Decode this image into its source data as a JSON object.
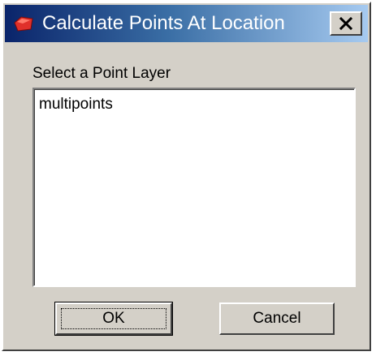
{
  "window": {
    "title": "Calculate Points At Location",
    "app_icon": "layer-icon",
    "close_icon": "close-icon",
    "close_label": "✕"
  },
  "form": {
    "prompt": "Select a Point Layer",
    "layers": [
      "multipoints"
    ],
    "selected": null
  },
  "buttons": {
    "ok_label": "OK",
    "cancel_label": "Cancel"
  },
  "colors": {
    "title_gradient_start": "#0a246a",
    "title_gradient_end": "#a6caf0",
    "face": "#d4d0c8"
  }
}
